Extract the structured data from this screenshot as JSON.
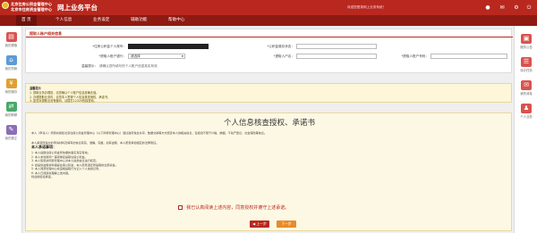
{
  "header": {
    "org_line1": "北京住房公积金管理中心",
    "org_line2": "北京市住房资金管理中心",
    "title": "网上业务平台",
    "user_info": "欢迎您登录网上业务系统！",
    "colors": {
      "brand_red": "#b8281e",
      "nav_red": "#8f1a12",
      "accent_orange": "#e88a2a"
    }
  },
  "nav": {
    "items": [
      {
        "label": "首 页",
        "icon": "home-icon"
      },
      {
        "label": "个人信息",
        "icon": ""
      },
      {
        "label": "业务设定",
        "icon": "chevron-down-icon"
      },
      {
        "label": "辅助功能",
        "icon": "chevron-down-icon"
      },
      {
        "label": "帮助中心",
        "icon": "chevron-down-icon"
      }
    ],
    "active_index": 0
  },
  "left_sidebar": {
    "items": [
      {
        "label": "我的提取",
        "icon": "id-card-icon"
      },
      {
        "label": "我的贷款",
        "icon": "house-icon"
      },
      {
        "label": "我的缴存",
        "icon": "coin-icon"
      },
      {
        "label": "我的转移",
        "icon": "transfer-icon"
      },
      {
        "label": "我的更正",
        "icon": "edit-icon"
      }
    ]
  },
  "right_sidebar": {
    "items": [
      {
        "label": "服务公告",
        "icon": "notice-icon"
      },
      {
        "label": "待办任务",
        "icon": "task-icon"
      },
      {
        "label": "我的消息",
        "icon": "message-icon"
      },
      {
        "label": "个人业务",
        "icon": "user-icon"
      }
    ]
  },
  "form": {
    "title": "提取人账户相关信息",
    "account_label": "*住房公积金个人账号：",
    "account_value": "",
    "provident_label": "*公积金缴存状态：",
    "provident_value": "",
    "bank_label": "*提取人账户银行：",
    "bank_value": "请选择",
    "account_name_label": "*提取人户名：",
    "account_name_value": "",
    "bank_account_label": "*提取人账户号码：",
    "bank_account_value": "",
    "note_label": "温馨提示：",
    "note_value": "请确认您所填写的个人账户信息真实有效"
  },
  "notice": {
    "title": "温馨提示",
    "lines": [
      "1. 提取业务办理前，请您确认个人账户信息准确无误。",
      "2. 办理提取业务时，请您本人签署个人信息核查授权、承诺书。",
      "3. 如您对提取业务有疑问，请拨打12329热线咨询。"
    ]
  },
  "promise": {
    "title": "个人信息核查授权、承诺书",
    "lines": [
      "本人（申请人）同意并授权北京住房公积金管理中心（以下简称管理中心）通过政府信息共享、数据交换等方式核查本人的相关信息，包括但不限于户籍、婚姻、不动产登记、社会保险等信息。",
      "本人承诺所提交的申请材料及填写的信息真实、准确、完整，如有虚假，本人愿意承担相应的法律责任。",
      "本人承诺事项：",
      "1. 本人提取住房公积金所依据的事实真实有效。",
      "2. 本人未利用同一事项重复提取住房公积金。",
      "3. 本人知晓并同意管理中心对本人提供信息进行核查。",
      "4. 如提供虚假材料骗提住房公积金，本人愿意退还所提取的全部资金。",
      "5. 本人同意管理中心将违规提取行为记入个人信用记录。",
      "6. 本人已阅读并理解上述内容。",
      "特此授权和承诺。"
    ],
    "agree_label": "我已认真阅读上述内容，同意授权并遵守上述承诺。",
    "prev_button": "◀ 上一步",
    "next_button": "下一步"
  }
}
